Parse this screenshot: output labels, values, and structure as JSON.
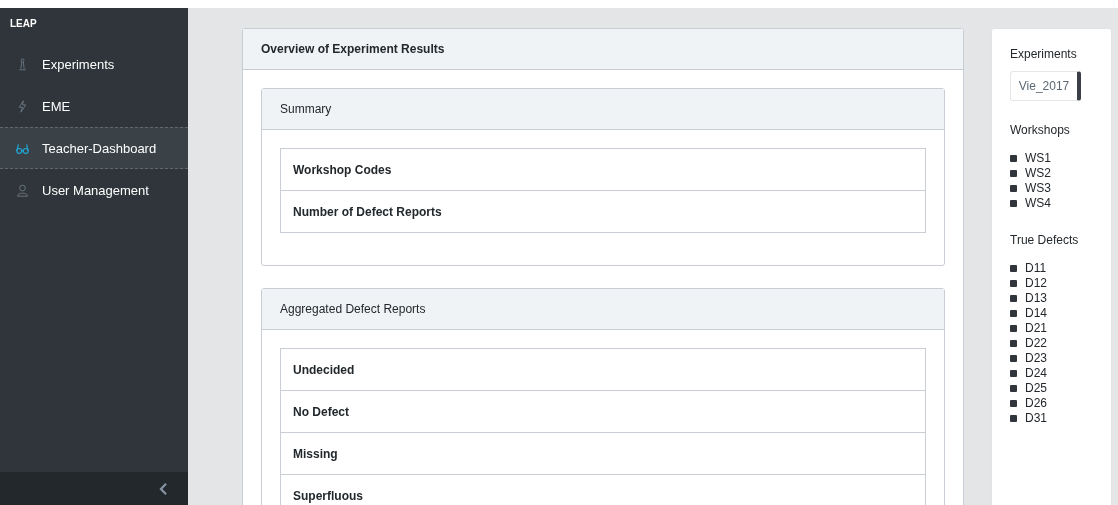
{
  "sidebar": {
    "brand": "LEAP",
    "items": [
      {
        "label": "Experiments",
        "selected": false
      },
      {
        "label": "EME",
        "selected": false
      },
      {
        "label": "Teacher-Dashboard",
        "selected": true
      },
      {
        "label": "User Management",
        "selected": false
      }
    ]
  },
  "main": {
    "title": "Overview of Experiment Results",
    "panels": [
      {
        "title": "Summary",
        "rows": [
          "Workshop Codes",
          "Number of Defect Reports"
        ]
      },
      {
        "title": "Aggregated Defect Reports",
        "rows": [
          "Undecided",
          "No Defect",
          "Missing",
          "Superfluous"
        ]
      }
    ]
  },
  "filters": {
    "experiments_label": "Experiments",
    "experiment_value": "Vie_2017",
    "groups": [
      {
        "title": "Workshops",
        "items": [
          "WS1",
          "WS2",
          "WS3",
          "WS4"
        ]
      },
      {
        "title": "True Defects",
        "items": [
          "D11",
          "D12",
          "D13",
          "D14",
          "D21",
          "D22",
          "D23",
          "D24",
          "D25",
          "D26",
          "D31"
        ]
      }
    ]
  }
}
